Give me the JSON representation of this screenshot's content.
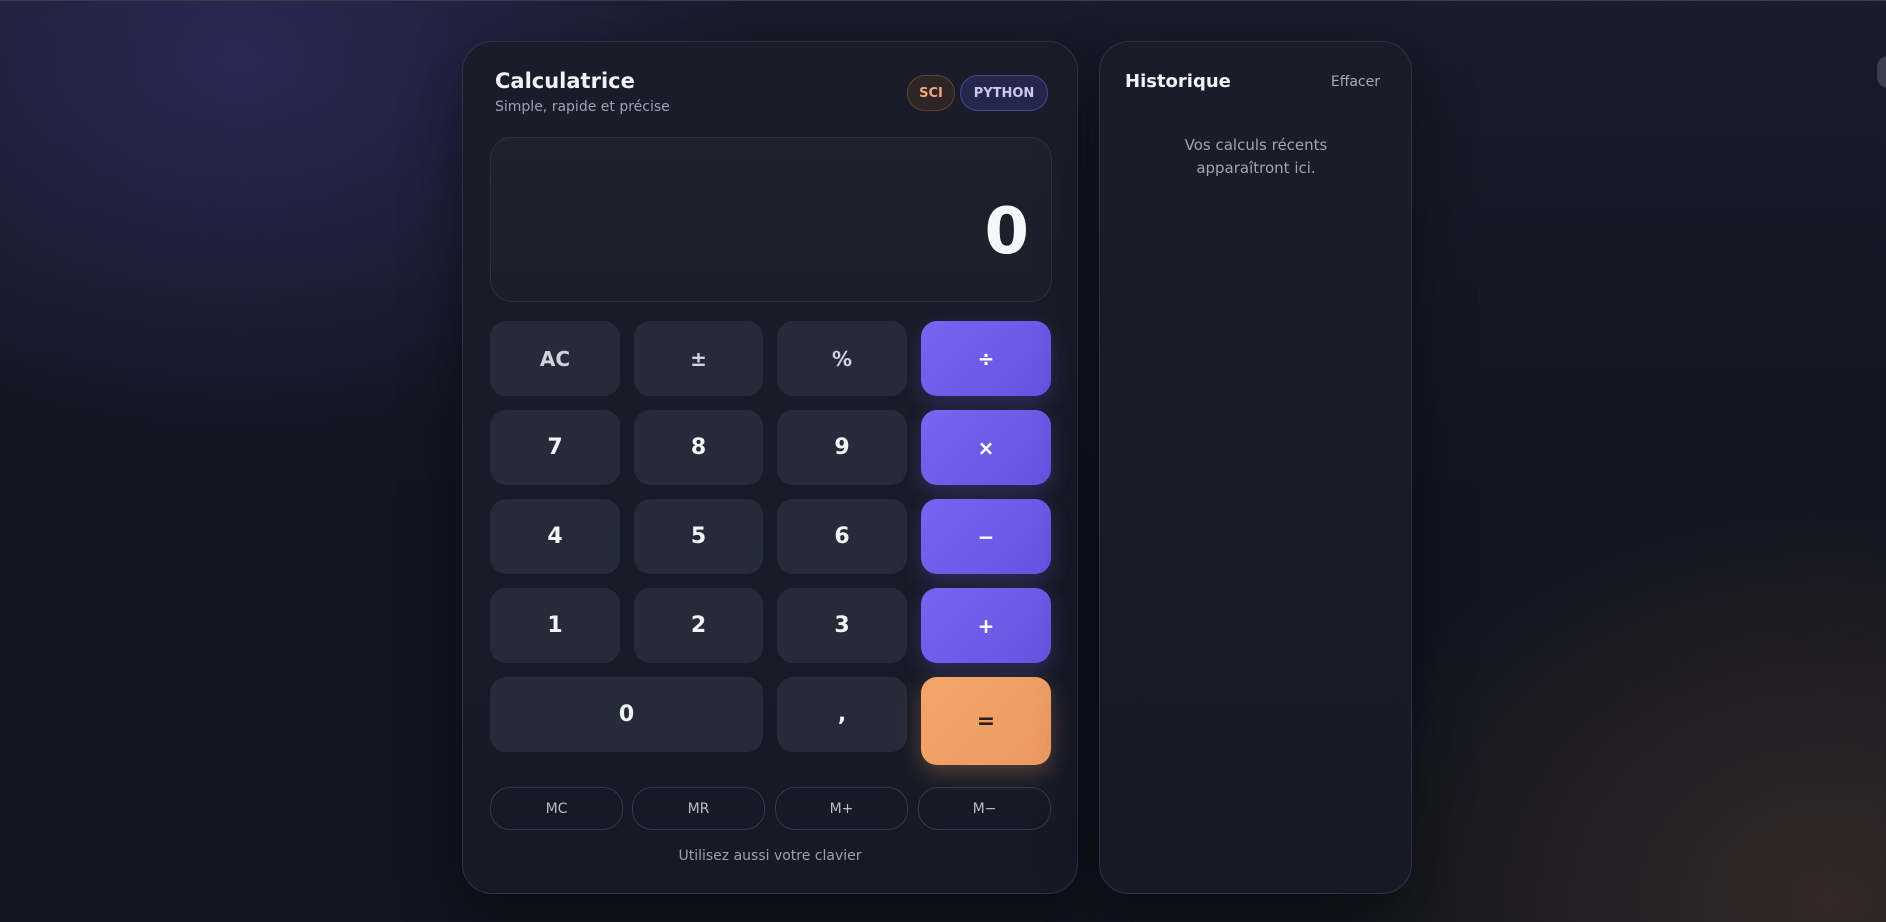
{
  "calculator": {
    "title": "Calculatrice",
    "subtitle": "Simple, rapide et précise",
    "badges": {
      "sci": "SCI",
      "python": "PYTHON"
    },
    "display": "0",
    "keys": {
      "ac": "AC",
      "sign": "±",
      "percent": "%",
      "divide": "÷",
      "seven": "7",
      "eight": "8",
      "nine": "9",
      "multiply": "×",
      "four": "4",
      "five": "5",
      "six": "6",
      "minus": "−",
      "one": "1",
      "two": "2",
      "three": "3",
      "plus": "+",
      "zero": "0",
      "comma": ",",
      "equals": "="
    },
    "memory": {
      "mc": "MC",
      "mr": "MR",
      "mplus": "M+",
      "mminus": "M−"
    },
    "hint": "Utilisez aussi votre clavier"
  },
  "history": {
    "title": "Historique",
    "clear_label": "Effacer",
    "empty_message": "Vos calculs récents apparaîtront ici."
  },
  "colors": {
    "operator_accent": "#6f5ae9",
    "equals_accent": "#f2a265",
    "key_background": "#262b3a",
    "card_background": "#181b27"
  }
}
